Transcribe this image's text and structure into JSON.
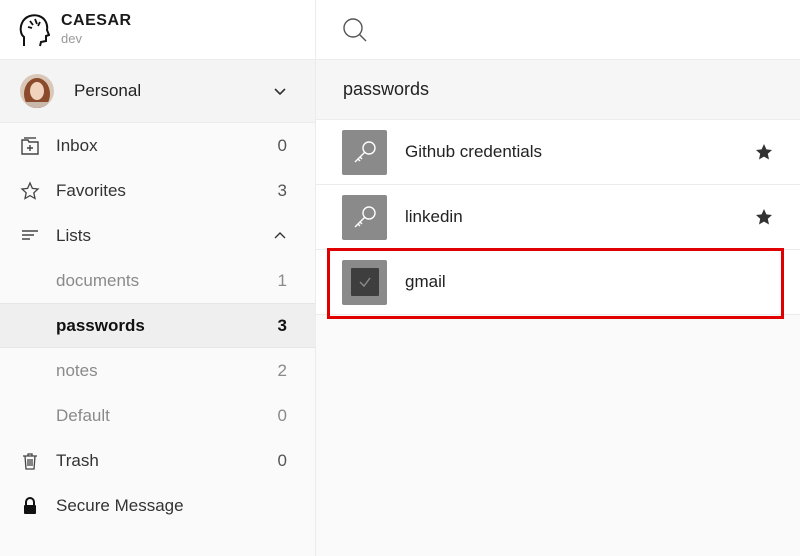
{
  "brand": {
    "name": "CAESAR",
    "env": "dev"
  },
  "account": {
    "name": "Personal"
  },
  "nav": {
    "inbox": {
      "label": "Inbox",
      "count": "0"
    },
    "favorites": {
      "label": "Favorites",
      "count": "3"
    },
    "lists": {
      "label": "Lists"
    },
    "documents": {
      "label": "documents",
      "count": "1"
    },
    "passwords": {
      "label": "passwords",
      "count": "3"
    },
    "notes": {
      "label": "notes",
      "count": "2"
    },
    "default": {
      "label": "Default",
      "count": "0"
    },
    "trash": {
      "label": "Trash",
      "count": "0"
    },
    "secure": {
      "label": "Secure Message"
    }
  },
  "list": {
    "title": "passwords",
    "items": [
      {
        "title": "Github credentials",
        "icon": "key-icon",
        "favorite": true
      },
      {
        "title": "linkedin",
        "icon": "key-icon",
        "favorite": true
      },
      {
        "title": "gmail",
        "icon": "checkbox-icon",
        "favorite": false,
        "selected": true
      }
    ]
  },
  "colors": {
    "highlight": "#e00000",
    "tile": "#8a8a8a"
  }
}
